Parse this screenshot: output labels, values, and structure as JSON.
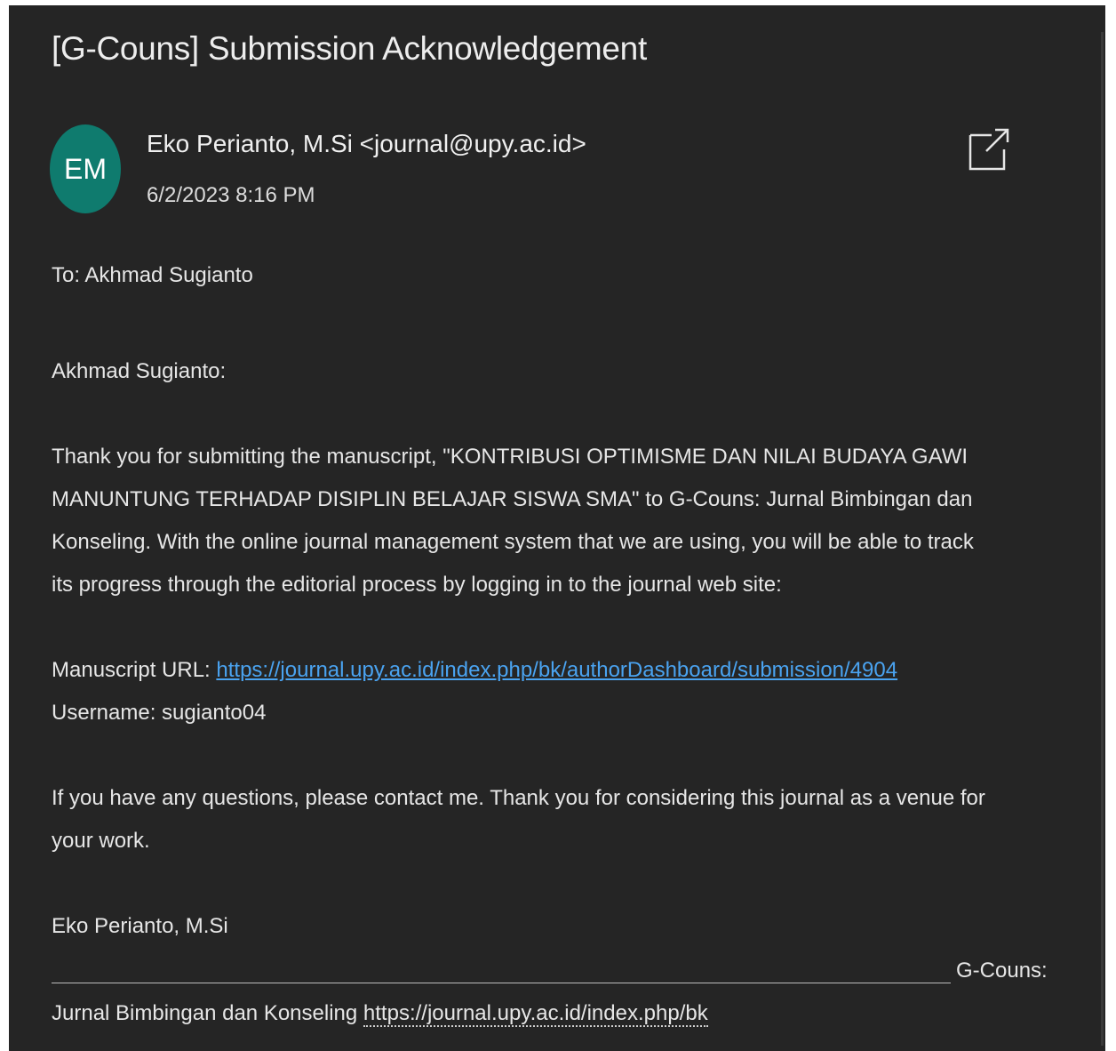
{
  "email": {
    "subject": "[G-Couns] Submission Acknowledgement",
    "avatar_initials": "EM",
    "sender": "Eko Perianto, M.Si <journal@upy.ac.id>",
    "sent_time": "6/2/2023 8:16 PM",
    "to": "To: Akhmad Sugianto",
    "greeting": "Akhmad Sugianto:",
    "paragraph1_lines": [
      "Thank you for submitting the manuscript, \"KONTRIBUSI OPTIMISME DAN NILAI BUDAYA GAWI",
      "MANUNTUNG TERHADAP DISIPLIN BELAJAR SISWA SMA\" to G-Couns: Jurnal Bimbingan dan",
      "Konseling. With the online journal management system that we are using, you will be able to track",
      "its progress through the editorial process by logging in to the journal web site:"
    ],
    "manuscript_url_label": "Manuscript URL: ",
    "manuscript_url": "https://journal.upy.ac.id/index.php/bk/authorDashboard/submission/4904",
    "username_line": "Username: sugianto04",
    "paragraph2_lines": [
      "If you have any questions, please contact me. Thank you for considering this journal as a venue for",
      "your work."
    ],
    "signature_name": "Eko Perianto, M.Si",
    "signature_journal_right": "G-Couns:",
    "signature_journal_left": "Jurnal Bimbingan dan Konseling ",
    "signature_url": "https://journal.upy.ac.id/index.php/bk"
  },
  "icons": {
    "popout": "popout-window-icon"
  },
  "colors": {
    "background": "#252525",
    "avatar": "#0f7b6e",
    "link": "#4aa3f0"
  }
}
